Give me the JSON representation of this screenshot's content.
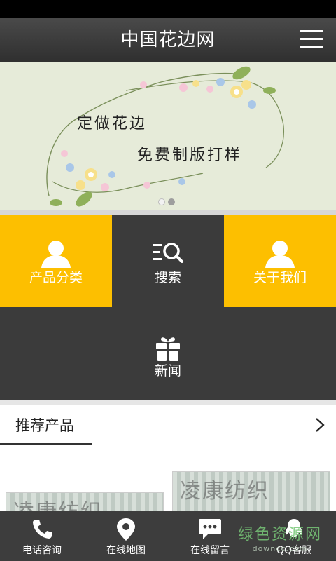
{
  "header": {
    "title": "中国花边网",
    "menu_icon": "hamburger-menu-icon"
  },
  "banner": {
    "line1": "定做花边",
    "line2": "免费制版打样",
    "slides": 2,
    "active_slide": 2
  },
  "tiles": [
    {
      "label": "产品分类",
      "icon": "user-icon",
      "color": "#fdbf00"
    },
    {
      "label": "搜索",
      "icon": "search-list-icon",
      "color": "#3b3b3b"
    },
    {
      "label": "关于我们",
      "icon": "user-icon",
      "color": "#fdbf00"
    },
    {
      "label": "新闻",
      "icon": "gift-icon",
      "color": "#3b3b3b"
    }
  ],
  "recommend": {
    "title": "推荐产品"
  },
  "products": [
    {
      "watermark": "凌康纺织"
    },
    {
      "watermark": "凌康纺织"
    }
  ],
  "bottom_nav": [
    {
      "label": "电话咨询",
      "icon": "phone-icon"
    },
    {
      "label": "在线地图",
      "icon": "map-pin-icon"
    },
    {
      "label": "在线留言",
      "icon": "message-icon"
    },
    {
      "label": "QQ客服",
      "icon": "qq-icon"
    }
  ],
  "watermark": {
    "text": "绿色资源网",
    "url": "downcc.com"
  }
}
